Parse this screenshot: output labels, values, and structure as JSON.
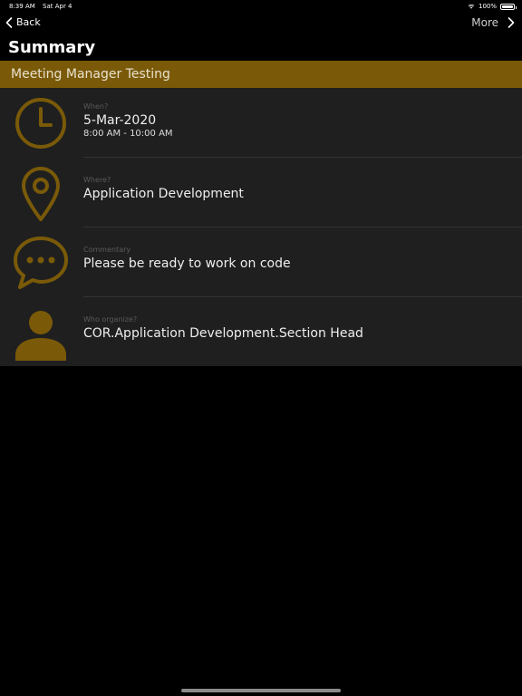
{
  "status": {
    "time": "8:39 AM",
    "date": "Sat Apr 4",
    "battery": "100%"
  },
  "nav": {
    "back_label": "Back",
    "more_label": "More"
  },
  "page": {
    "title": "Summary"
  },
  "meeting": {
    "title": "Meeting Manager Testing"
  },
  "details": {
    "when": {
      "label": "When?",
      "date": "5-Mar-2020",
      "time": "8:00 AM - 10:00 AM"
    },
    "where": {
      "label": "Where?",
      "value": "Application Development"
    },
    "commentary": {
      "label": "Commentary",
      "value": "Please be ready to work on code"
    },
    "organizer": {
      "label": "Who organize?",
      "value": "COR.Application Development.Section Head"
    }
  },
  "colors": {
    "accent": "#7a5a08",
    "icon": "#7a5a08",
    "row_bg": "#1f1f1f",
    "background": "#000000"
  },
  "icons": [
    "clock-icon",
    "location-pin-icon",
    "chat-bubble-icon",
    "person-icon"
  ]
}
